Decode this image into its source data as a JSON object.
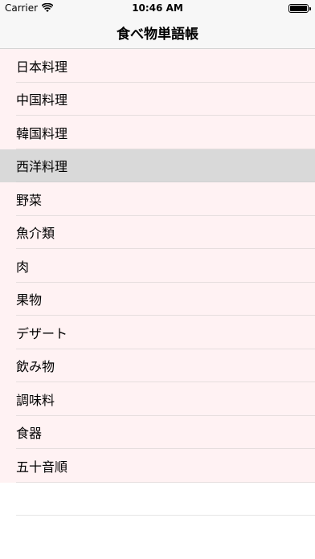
{
  "status_bar": {
    "carrier": "Carrier",
    "time": "10:46 AM"
  },
  "nav": {
    "title": "食べ物単語帳"
  },
  "list": {
    "items": [
      {
        "label": "日本料理"
      },
      {
        "label": "中国料理"
      },
      {
        "label": "韓国料理"
      },
      {
        "label": "西洋料理",
        "selected": true
      },
      {
        "label": "野菜"
      },
      {
        "label": "魚介類"
      },
      {
        "label": "肉"
      },
      {
        "label": "果物"
      },
      {
        "label": "デザート"
      },
      {
        "label": "飲み物"
      },
      {
        "label": "調味料"
      },
      {
        "label": "食器"
      },
      {
        "label": "五十音順"
      }
    ]
  },
  "colors": {
    "row_background": "#fff2f3",
    "selected_background": "#d9d9d9",
    "bar_background": "#f7f7f7"
  },
  "icons": [
    "wifi-icon",
    "battery-icon"
  ]
}
